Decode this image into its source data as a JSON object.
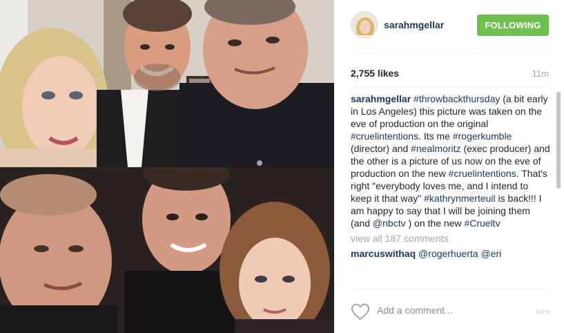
{
  "post": {
    "username": "sarahmgellar",
    "follow_label": "FOLLOWING",
    "likes": "2,755 likes",
    "time": "11m",
    "caption": {
      "user": "sarahmgellar",
      "p1": " ",
      "t1": "#throwbackthursday",
      "p2": " (a bit early in Los Angeles) this picture was taken on the eve of production on the original ",
      "t2": "#cruelintentions",
      "p3": ". Its me ",
      "t3": "#rogerkumble",
      "p4": " (director) and ",
      "t4": "#nealmoritz",
      "p5": " (exec producer) and the other is a picture of us now on the eve of production on the new ",
      "t5": "#cruelintentions",
      "p6": ". That's right \"everybody loves me, and I intend to keep it that way\" ",
      "t6": "#kathrynmerteuil",
      "p7": " is back!!! I am happy to say that I will be joining them (and ",
      "t7": "@nbctv",
      "p8": " ) on the new ",
      "t8": "#Crueltv"
    },
    "view_all": "view all 187 comments",
    "comment": {
      "user": "marcuswithaq",
      "text1": " ",
      "m1": "@rogerhuerta",
      "text2": " ",
      "m2": "@eri"
    },
    "add_comment_placeholder": "Add a comment...",
    "more_label": "○○○"
  },
  "icons": {
    "like": "heart-outline-icon",
    "more": "more-options-icon"
  },
  "colors": {
    "follow_button": "#70c050",
    "link": "#20385c",
    "muted": "#a5a7aa"
  }
}
